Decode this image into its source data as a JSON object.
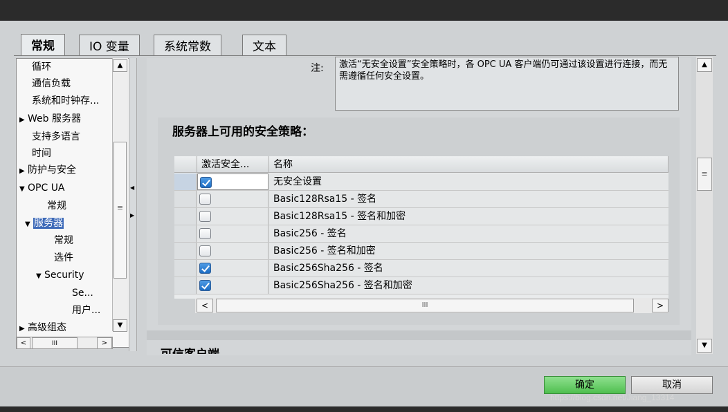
{
  "tabs": [
    "常规",
    "IO 变量",
    "系统常数",
    "文本"
  ],
  "nav": {
    "items": [
      {
        "label": "循环",
        "indent": 0,
        "arrow": ""
      },
      {
        "label": "通信负载",
        "indent": 0,
        "arrow": ""
      },
      {
        "label": "系统和时钟存...",
        "indent": 0,
        "arrow": ""
      },
      {
        "label": "Web 服务器",
        "indent": 0,
        "arrow": "▶"
      },
      {
        "label": "支持多语言",
        "indent": 0,
        "arrow": ""
      },
      {
        "label": "时间",
        "indent": 0,
        "arrow": ""
      },
      {
        "label": "防护与安全",
        "indent": 0,
        "arrow": "▶"
      },
      {
        "label": "OPC UA",
        "indent": 0,
        "arrow": "▼"
      },
      {
        "label": "常规",
        "indent": 2,
        "arrow": ""
      },
      {
        "label": "服务器",
        "indent": 1,
        "arrow": "▼"
      },
      {
        "label": "常规",
        "indent": 3,
        "arrow": ""
      },
      {
        "label": "选件",
        "indent": 3,
        "arrow": ""
      },
      {
        "label": "Security",
        "indent": 2,
        "arrow": "▼"
      },
      {
        "label": "Se...",
        "indent": 4,
        "arrow": ""
      },
      {
        "label": "用户...",
        "indent": 4,
        "arrow": ""
      },
      {
        "label": "高级组态",
        "indent": 0,
        "arrow": "▶"
      }
    ],
    "scroll_up": "▲",
    "scroll_down": "▼",
    "thumb": "≡",
    "h_left": "<",
    "h_right": ">",
    "h_thumb": "III"
  },
  "note": {
    "label": "注:",
    "text": "激活“无安全设置”安全策略时，各 OPC UA 客户端仍可通过该设置进行连接，而无需遵循任何安全设置。"
  },
  "section_title": "服务器上可用的安全策略：",
  "next_section_title": "可信客户端",
  "table": {
    "headers": [
      "激活安全...",
      "名称"
    ],
    "rows": [
      {
        "checked": true,
        "name": "无安全设置"
      },
      {
        "checked": false,
        "name": "Basic128Rsa15 - 签名"
      },
      {
        "checked": false,
        "name": "Basic128Rsa15 - 签名和加密"
      },
      {
        "checked": false,
        "name": "Basic256 - 签名"
      },
      {
        "checked": false,
        "name": "Basic256 - 签名和加密"
      },
      {
        "checked": true,
        "name": "Basic256Sha256 - 签名"
      },
      {
        "checked": true,
        "name": "Basic256Sha256 - 签名和加密"
      }
    ],
    "h_left": "<",
    "h_right": ">",
    "h_thumb": "III"
  },
  "right_scroll": {
    "up": "▲",
    "down": "▼",
    "thumb": "≡"
  },
  "buttons": {
    "ok": "确定",
    "cancel": "取消"
  },
  "watermark": "https://blog.csdn.net/Jiang_13314"
}
